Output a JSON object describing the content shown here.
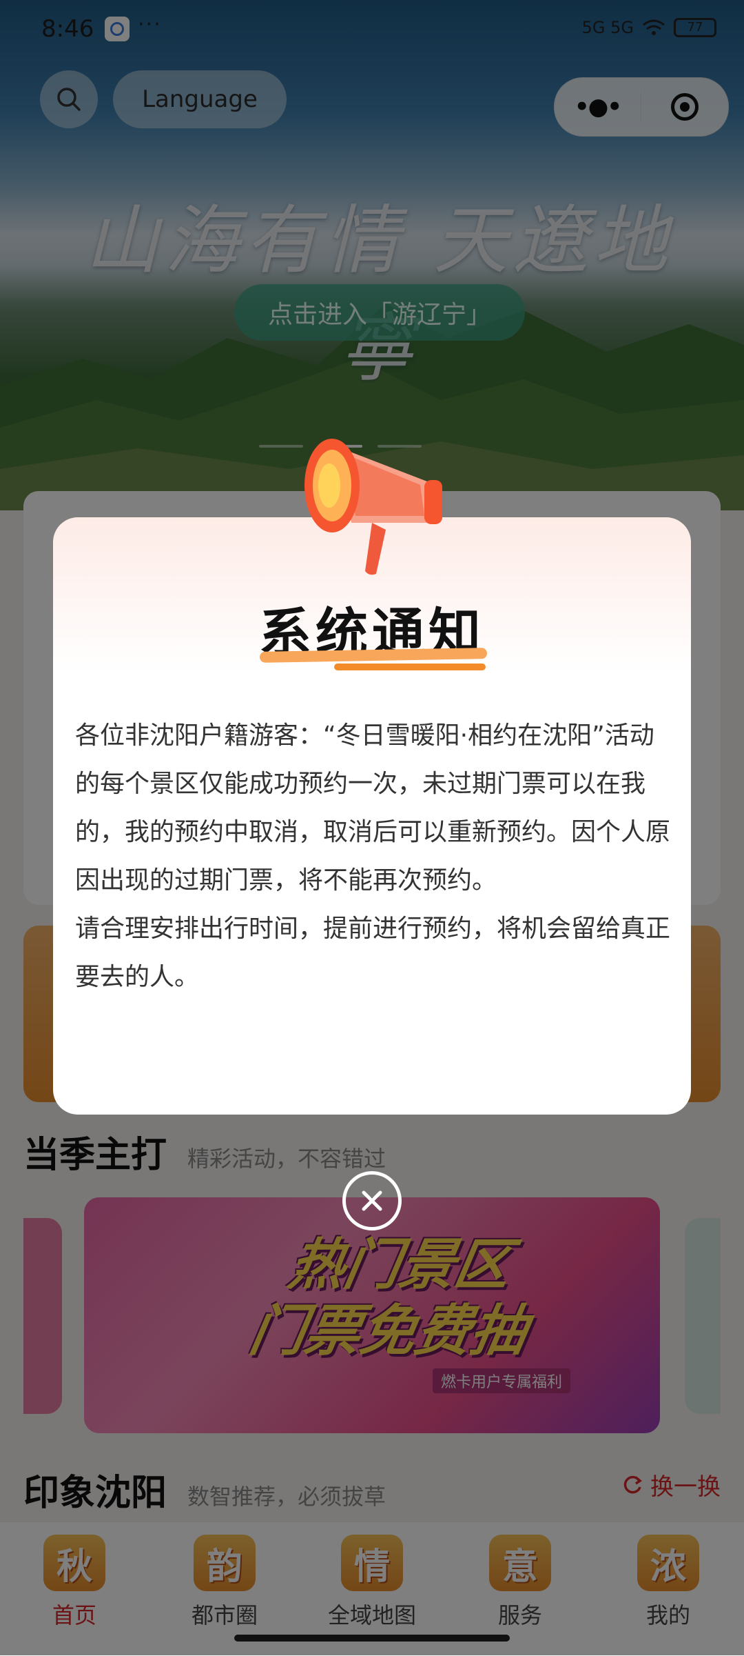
{
  "status_bar": {
    "time": "8:46",
    "dots": "···",
    "network": "5G 5G",
    "battery": "77"
  },
  "header": {
    "language_label": "Language"
  },
  "hero": {
    "title": "山海有情 天遼地寧",
    "cta_label": "点击进入「游辽宁」"
  },
  "sections": {
    "season": {
      "title": "当季主打",
      "subtitle": "精彩活动，不容错过"
    },
    "banner": {
      "headline_line1": "热门景区",
      "headline_line2": "门票免费抽",
      "tagline": "燃卡用户专属福利"
    },
    "impression": {
      "title": "印象沈阳",
      "subtitle": "数智推荐，必须拔草",
      "refresh_label": "换一换"
    }
  },
  "tabbar": {
    "items": [
      {
        "icon_char": "秋",
        "label": "首页",
        "active": true
      },
      {
        "icon_char": "韵",
        "label": "都市圈",
        "active": false
      },
      {
        "icon_char": "情",
        "label": "全域地图",
        "active": false
      },
      {
        "icon_char": "意",
        "label": "服务",
        "active": false
      },
      {
        "icon_char": "浓",
        "label": "我的",
        "active": false
      }
    ]
  },
  "dialog": {
    "title": "系统通知",
    "paragraphs": [
      "各位非沈阳户籍游客：“冬日雪暖阳·相约在沈阳”活动的每个景区仅能成功预约一次，未过期门票可以在我的，我的预约中取消，取消后可以重新预约。因个人原因出现的过期门票，将不能再次预约。",
      "请合理安排出行时间，提前进行预约，将机会留给真正要去的人。"
    ]
  },
  "colors": {
    "accent_red": "#d9262b",
    "accent_orange": "#f48b2b",
    "cta_green": "#3ca082"
  },
  "icons": [
    "search-icon",
    "more-icon",
    "target-icon",
    "megaphone-icon",
    "close-icon",
    "refresh-icon"
  ]
}
